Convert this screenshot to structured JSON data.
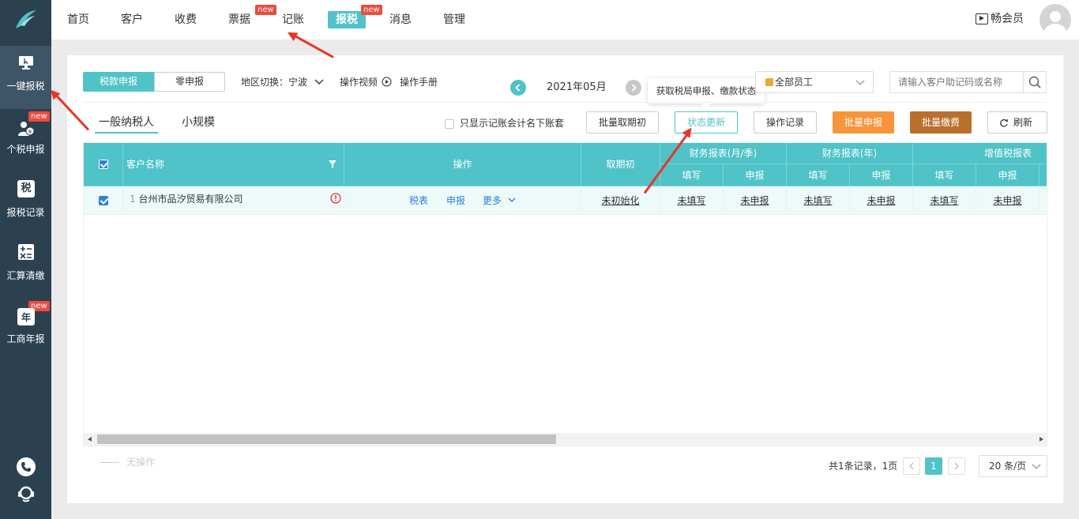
{
  "nav": {
    "items": [
      {
        "label": "首页"
      },
      {
        "label": "客户"
      },
      {
        "label": "收费"
      },
      {
        "label": "票据",
        "badge": "new"
      },
      {
        "label": "记账"
      },
      {
        "label": "报税",
        "badge": "new",
        "active": true
      },
      {
        "label": "消息"
      },
      {
        "label": "管理"
      }
    ],
    "vip_label": "畅会员"
  },
  "sidebar": {
    "items": [
      {
        "label": "一键报税",
        "icon": "monitor-icon",
        "active": true
      },
      {
        "label": "个税申报",
        "icon": "person-tax-icon",
        "badge": "new"
      },
      {
        "label": "报税记录",
        "icon": "tax-record-icon",
        "glyph": "税"
      },
      {
        "label": "汇算清缴",
        "icon": "calculator-icon"
      },
      {
        "label": "工商年报",
        "icon": "calendar-icon",
        "badge": "new",
        "glyph": "年"
      }
    ]
  },
  "toolbar": {
    "tab_tax": "税款申报",
    "tab_zero": "零申报",
    "region_label": "地区切换：宁波",
    "video_label": "操作视频",
    "manual_label": "操作手册",
    "period": "2021年05月",
    "employee_select": "全部员工",
    "search_placeholder": "请输入客户助记码或名称",
    "tooltip": "获取税局申报、缴款状态"
  },
  "subtabs": {
    "general": "一般纳税人",
    "small": "小规模"
  },
  "actions": {
    "only_show_label": "只显示记账会计名下账套",
    "batch_cancel_init": "批量取期初",
    "status_update": "状态更新",
    "op_log": "操作记录",
    "batch_declare": "批量申报",
    "batch_pay": "批量缴费",
    "refresh": "刷新"
  },
  "table": {
    "headers": {
      "name": "客户名称",
      "ops": "操作",
      "init": "取期初",
      "fin_month": "财务报表(月/季)",
      "fin_year": "财务报表(年)",
      "vat": "增值税报表",
      "fill": "填写",
      "declare": "申报"
    },
    "rows": [
      {
        "index": "1",
        "name": "台州市品汐贸易有限公司",
        "op_tax": "税表",
        "op_declare": "申报",
        "op_more": "更多",
        "init": "未初始化",
        "fin_month_fill": "未填写",
        "fin_month_declare": "未申报",
        "fin_year_fill": "未填写",
        "fin_year_declare": "未申报",
        "vat_fill": "未填写",
        "vat_declare": "未申报"
      }
    ]
  },
  "footer": {
    "no_op": "无操作",
    "summary": "共1条记录，1页",
    "current_page": "1",
    "page_size": "20 条/页"
  },
  "colors": {
    "accent": "#4fc3c7",
    "sidebar": "#2c4150",
    "orange": "#f7953a",
    "brown": "#b8702c",
    "red": "#e8342b"
  }
}
